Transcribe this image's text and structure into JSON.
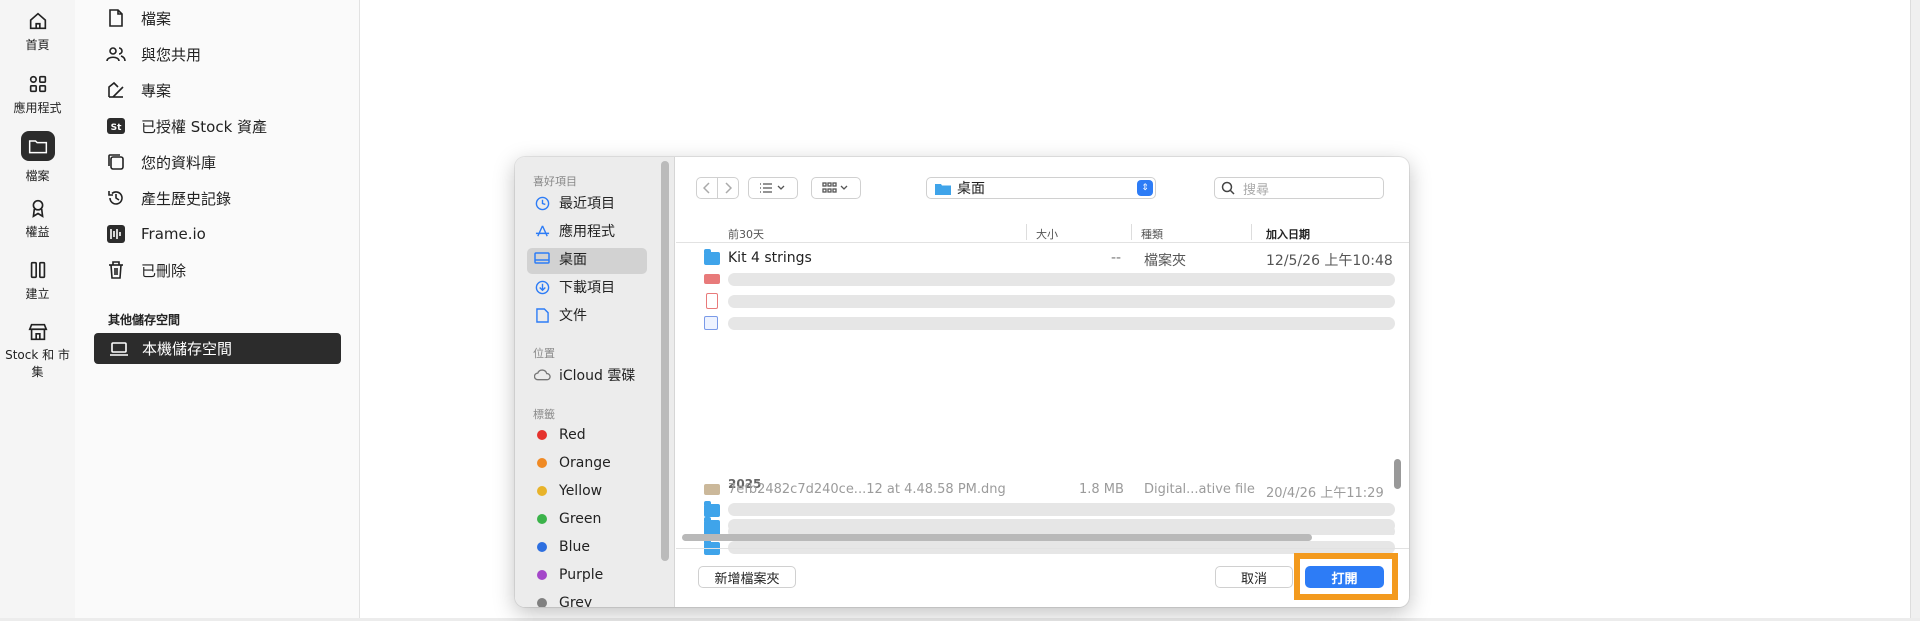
{
  "rail": {
    "items": [
      {
        "label": "首頁",
        "icon": "home-icon"
      },
      {
        "label": "應用程式",
        "icon": "apps-icon"
      },
      {
        "label": "檔案",
        "icon": "folder-icon"
      },
      {
        "label": "權益",
        "icon": "award-icon"
      },
      {
        "label": "建立",
        "icon": "create-icon"
      },
      {
        "label": "Stock 和 市集",
        "icon": "store-icon"
      }
    ]
  },
  "panel": {
    "items": [
      {
        "label": "檔案",
        "icon": "file-icon"
      },
      {
        "label": "與您共用",
        "icon": "shared-icon"
      },
      {
        "label": "專案",
        "icon": "project-icon"
      },
      {
        "label": "已授權 Stock 資產",
        "icon": "stock-icon"
      },
      {
        "label": "您的資料庫",
        "icon": "library-icon"
      },
      {
        "label": "產生歷史記錄",
        "icon": "history-icon"
      },
      {
        "label": "Frame.io",
        "icon": "frameio-icon"
      },
      {
        "label": "已刪除",
        "icon": "trash-icon"
      }
    ],
    "other_storage_label": "其他儲存空間",
    "local_storage_label": "本機儲存空間"
  },
  "dialog": {
    "sidebar": {
      "favorites_header": "喜好項目",
      "favorites": [
        {
          "label": "最近項目",
          "icon": "clock-icon"
        },
        {
          "label": "應用程式",
          "icon": "apps-icon"
        },
        {
          "label": "桌面",
          "icon": "desktop-icon"
        },
        {
          "label": "下載項目",
          "icon": "download-icon"
        },
        {
          "label": "文件",
          "icon": "document-icon"
        }
      ],
      "locations_header": "位置",
      "locations": [
        {
          "label": "iCloud 雲碟",
          "icon": "cloud-icon"
        }
      ],
      "tags_header": "標籤",
      "tags": [
        {
          "label": "Red",
          "color": "#e5322d"
        },
        {
          "label": "Orange",
          "color": "#f08a24"
        },
        {
          "label": "Yellow",
          "color": "#e8b32a"
        },
        {
          "label": "Green",
          "color": "#3bb34a"
        },
        {
          "label": "Blue",
          "color": "#2d6fe0"
        },
        {
          "label": "Purple",
          "color": "#a447c9"
        },
        {
          "label": "Grey",
          "color": "#808080"
        }
      ]
    },
    "toolbar": {
      "location": "桌面",
      "search_placeholder": "搜尋"
    },
    "columns": {
      "name": "前30天",
      "size": "大小",
      "kind": "種類",
      "date_added": "加入日期"
    },
    "rows": [
      {
        "name": "Kit 4 strings",
        "size": "--",
        "kind": "檔案夾",
        "date": "12/5/26 上午10:48"
      }
    ],
    "section_year": "2025",
    "last_row": {
      "name": "7efb2482c7d240ce...12 at 4.48.58 PM.dng",
      "size": "1.8 MB",
      "kind": "Digital...ative file",
      "date": "20/4/26 上午11:29"
    },
    "new_folder_label": "新增檔案夾",
    "cancel_label": "取消",
    "open_label": "打開"
  }
}
